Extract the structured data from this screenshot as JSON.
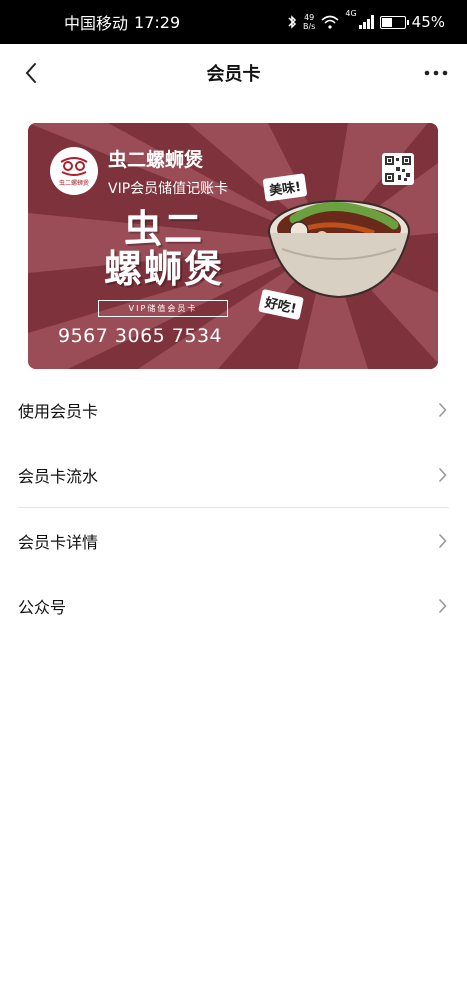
{
  "status_bar": {
    "carrier": "中国移动",
    "time": "17:29",
    "net_speed_value": "49",
    "net_speed_unit": "B/s",
    "network_type": "4G",
    "battery": "45%"
  },
  "nav": {
    "title": "会员卡",
    "back_icon": "chevron-left-icon",
    "more_icon": "more-horizontal-icon"
  },
  "card": {
    "logo_text": "虫二螺蛳煲",
    "brand_name": "虫二螺蛳煲",
    "card_type": "VIP会员储值记账卡",
    "big_name_line1": "虫二",
    "big_name_line2": "螺蛳煲",
    "vip_line": "VIP储值会员卡",
    "card_number": "9567 3065 7534",
    "stamp_1": "美味!",
    "stamp_2": "好吃!",
    "colors": {
      "background": "#8a3a44",
      "rays": "#a85560"
    }
  },
  "menu": {
    "items": [
      {
        "label": "使用会员卡"
      },
      {
        "label": "会员卡流水"
      },
      {
        "label": "会员卡详情"
      },
      {
        "label": "公众号"
      }
    ]
  }
}
